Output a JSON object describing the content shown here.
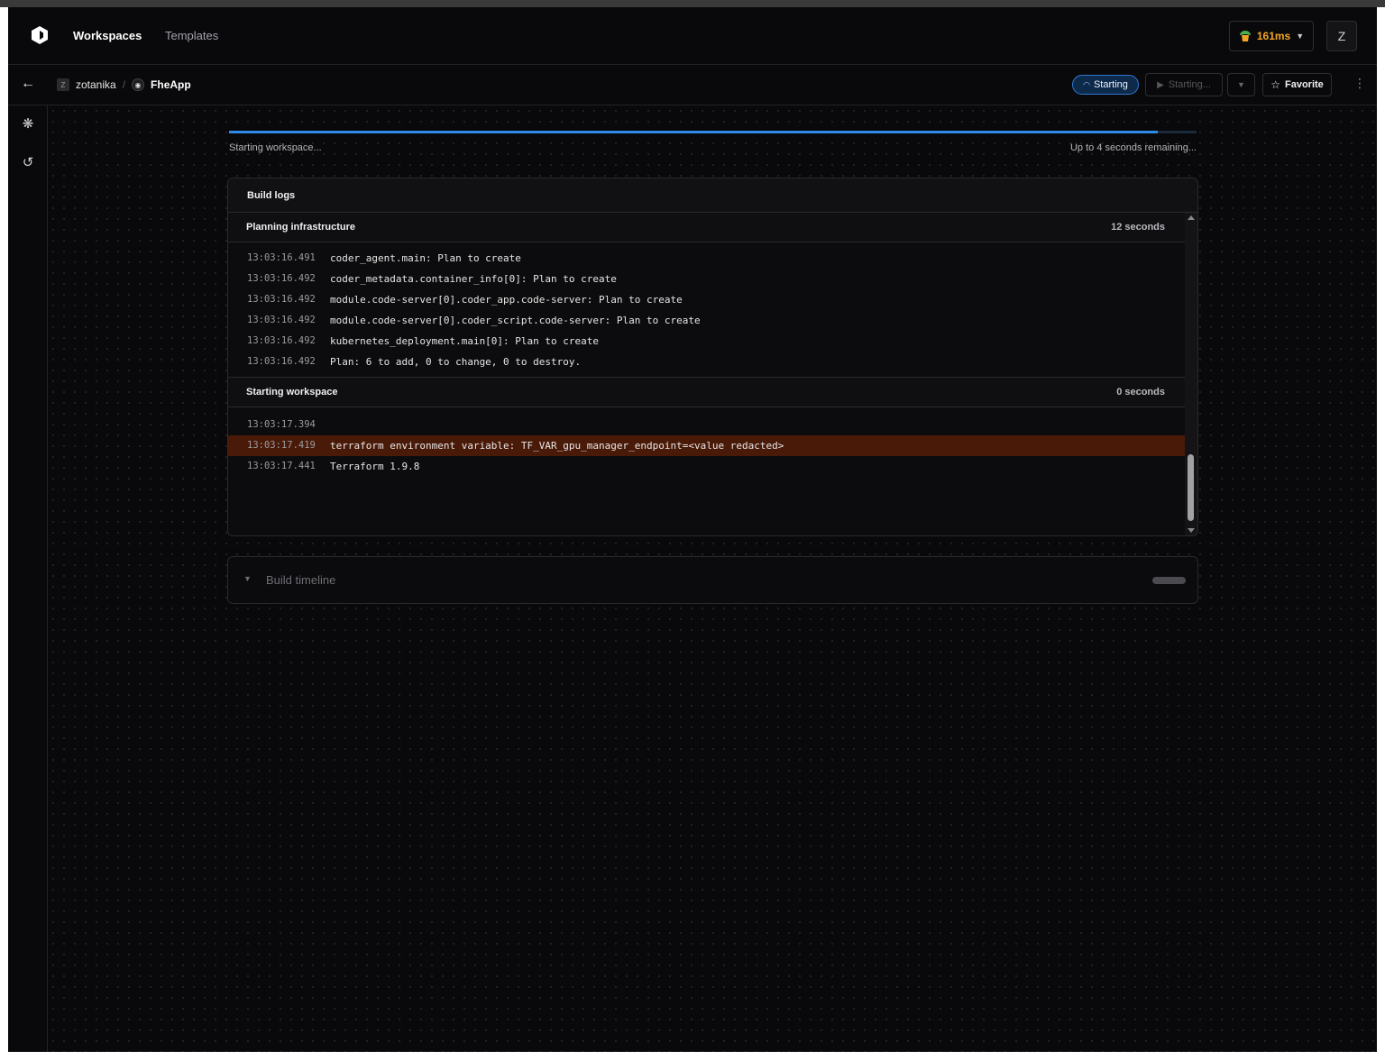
{
  "nav": {
    "links": [
      {
        "label": "Workspaces",
        "active": true
      },
      {
        "label": "Templates",
        "active": false
      }
    ],
    "latency": "161ms",
    "avatar_initial": "Z"
  },
  "subbar": {
    "owner_initial": "Z",
    "owner": "zotanika",
    "separator": "/",
    "workspace": "FheApp",
    "status": "Starting",
    "starting_button": "Starting...",
    "favorite_button": "Favorite"
  },
  "progress": {
    "label": "Starting workspace...",
    "remaining": "Up to 4 seconds remaining...",
    "fraction": 0.96
  },
  "build_logs": {
    "title": "Build logs",
    "stages": [
      {
        "name": "Planning infrastructure",
        "duration": "12 seconds",
        "lines": [
          {
            "ts": "13:03:16.491",
            "msg": "coder_agent.main: Plan to create",
            "level": "info"
          },
          {
            "ts": "13:03:16.492",
            "msg": "coder_metadata.container_info[0]: Plan to create",
            "level": "info"
          },
          {
            "ts": "13:03:16.492",
            "msg": "module.code-server[0].coder_app.code-server: Plan to create",
            "level": "info"
          },
          {
            "ts": "13:03:16.492",
            "msg": "module.code-server[0].coder_script.code-server: Plan to create",
            "level": "info"
          },
          {
            "ts": "13:03:16.492",
            "msg": "kubernetes_deployment.main[0]: Plan to create",
            "level": "info"
          },
          {
            "ts": "13:03:16.492",
            "msg": "Plan: 6 to add, 0 to change, 0 to destroy.",
            "level": "info"
          }
        ]
      },
      {
        "name": "Starting workspace",
        "duration": "0 seconds",
        "lines": [
          {
            "ts": "13:03:17.394",
            "msg": "",
            "level": "info"
          },
          {
            "ts": "13:03:17.419",
            "msg": "terraform environment variable: TF_VAR_gpu_manager_endpoint=<value redacted>",
            "level": "warn"
          },
          {
            "ts": "13:03:17.441",
            "msg": "Terraform 1.9.8",
            "level": "info"
          }
        ]
      }
    ]
  },
  "build_timeline": {
    "label": "Build timeline"
  },
  "colors": {
    "accent": "#2d8ae8",
    "warning_row": "#4a1a08",
    "latency": "#f5a524"
  },
  "icons": [
    "coder-logo-icon",
    "tree-icon",
    "chevron-down-icon",
    "arrow-left-icon",
    "star-icon",
    "kebab-icon",
    "graph-icon",
    "history-icon",
    "play-icon"
  ]
}
